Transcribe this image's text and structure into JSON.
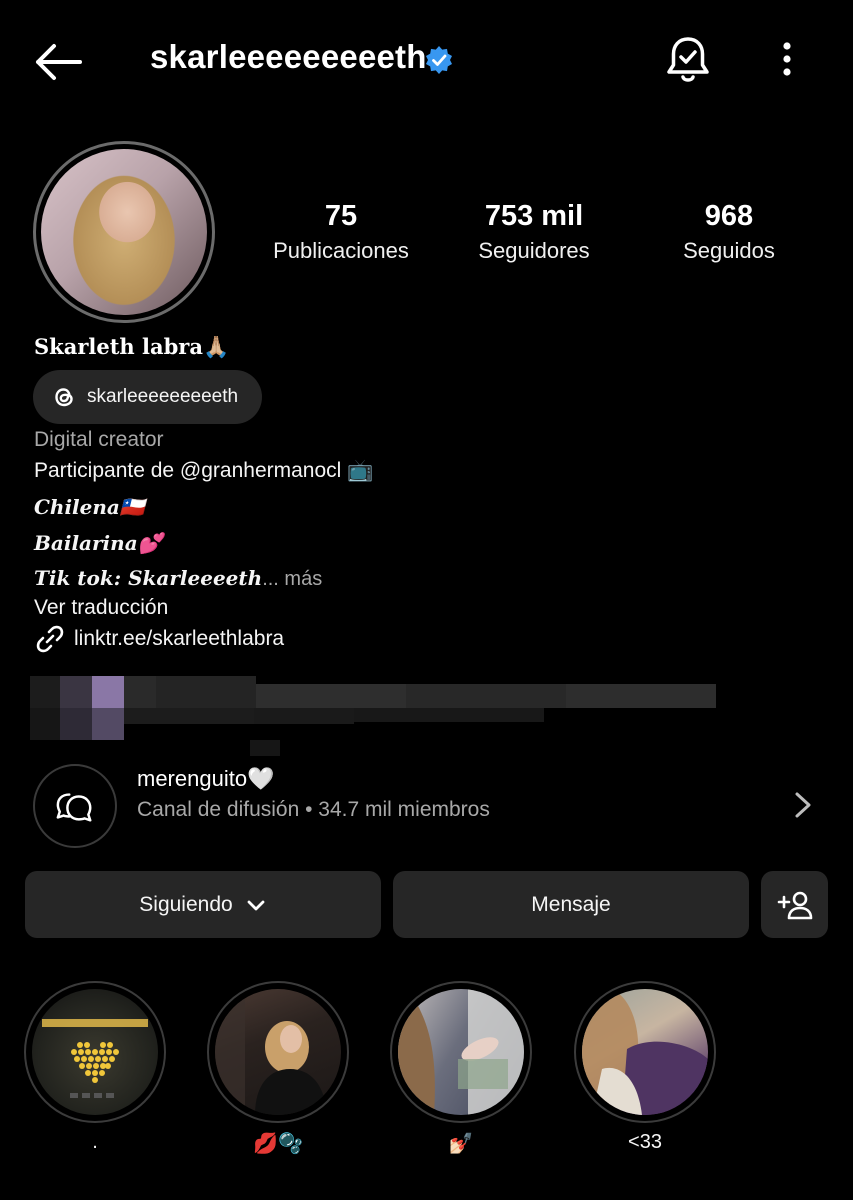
{
  "header": {
    "username": "skarleeeeeeeeeth",
    "back_icon": "arrow-left-icon",
    "bell_icon": "notification-bell-icon",
    "more_icon": "more-vertical-icon",
    "verified_color": "#3897f0"
  },
  "profile": {
    "stats": [
      {
        "value": "75",
        "label": "Publicaciones"
      },
      {
        "value": "753 mil",
        "label": "Seguidores"
      },
      {
        "value": "968",
        "label": "Seguidos"
      }
    ],
    "display_name": "Skarleth labra🙏🏼",
    "threads_handle": "skarleeeeeeeeeth",
    "category": "Digital creator",
    "bio": {
      "line1": "Participante de @granhermanocl 📺",
      "line2": "Chilena🇨🇱",
      "line3": "Bailarina💕",
      "line4_label": "Tik tok",
      "line4_colon": ": ",
      "line4_value": "Skarleeeeth",
      "line4_more": "... más",
      "translate": "Ver traducción"
    },
    "link": "linktr.ee/skarleethlabra"
  },
  "broadcast": {
    "title": "merenguito🤍",
    "subtitle": "Canal de difusión • 34.7 mil miembros"
  },
  "actions": {
    "following": "Siguiendo",
    "message": "Mensaje"
  },
  "highlights": [
    {
      "caption": "."
    },
    {
      "caption": "💋🫧"
    },
    {
      "caption": "💅🏻"
    },
    {
      "caption": "<33"
    }
  ]
}
